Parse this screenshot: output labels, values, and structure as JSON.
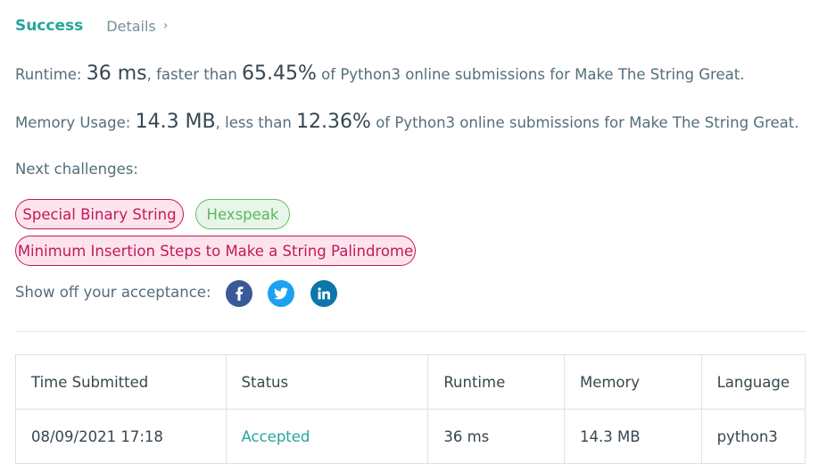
{
  "header": {
    "status": "Success",
    "details_label": "Details",
    "chevron": "›"
  },
  "runtime": {
    "label": "Runtime:",
    "value": "36 ms",
    "mid": ", faster than",
    "percent": "65.45%",
    "suffix": "of Python3 online submissions for Make The String Great."
  },
  "memory": {
    "label": "Memory Usage:",
    "value": "14.3 MB",
    "mid": ", less than",
    "percent": "12.36%",
    "suffix": "of Python3 online submissions for Make The String Great."
  },
  "next_challenges": {
    "label": "Next challenges:",
    "items": [
      {
        "label": "Special Binary String",
        "difficulty": "hard"
      },
      {
        "label": "Hexspeak",
        "difficulty": "easy"
      },
      {
        "label": "Minimum Insertion Steps to Make a String Palindrome",
        "difficulty": "hard"
      }
    ]
  },
  "share": {
    "label": "Show off your acceptance:",
    "icons": [
      "facebook-icon",
      "twitter-icon",
      "linkedin-icon"
    ]
  },
  "table": {
    "headers": [
      "Time Submitted",
      "Status",
      "Runtime",
      "Memory",
      "Language"
    ],
    "rows": [
      [
        "08/09/2021 17:18",
        "Accepted",
        "36 ms",
        "14.3 MB",
        "python3"
      ]
    ]
  },
  "colors": {
    "success": "#26a69a",
    "hard": "#c2185b",
    "easy": "#5cb85c",
    "facebook": "#3b5998",
    "twitter": "#1da1f2",
    "linkedin": "#0e76a8"
  }
}
